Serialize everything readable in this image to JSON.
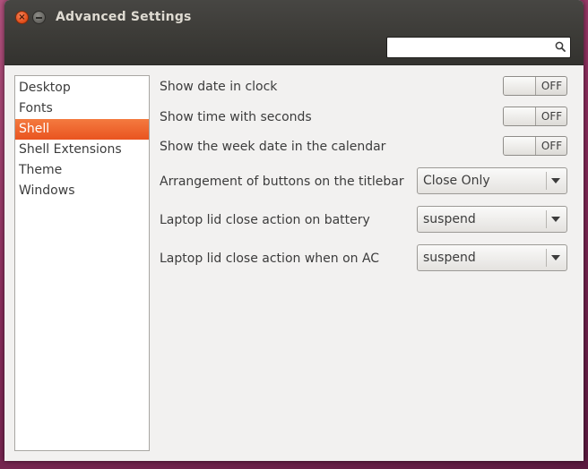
{
  "window": {
    "title": "Advanced Settings"
  },
  "search": {
    "value": "",
    "placeholder": ""
  },
  "sidebar": {
    "items": [
      {
        "label": "Desktop",
        "selected": false
      },
      {
        "label": "Fonts",
        "selected": false
      },
      {
        "label": "Shell",
        "selected": true
      },
      {
        "label": "Shell Extensions",
        "selected": false
      },
      {
        "label": "Theme",
        "selected": false
      },
      {
        "label": "Windows",
        "selected": false
      }
    ]
  },
  "settings": {
    "date_in_clock": {
      "label": "Show date in clock",
      "state": "OFF"
    },
    "time_with_seconds": {
      "label": "Show time with seconds",
      "state": "OFF"
    },
    "week_date": {
      "label": "Show the week date in the calendar",
      "state": "OFF"
    },
    "titlebar_buttons": {
      "label": "Arrangement of buttons on the titlebar",
      "value": "Close Only"
    },
    "lid_battery": {
      "label": "Laptop lid close action on battery",
      "value": "suspend"
    },
    "lid_ac": {
      "label": "Laptop lid close action when on AC",
      "value": "suspend"
    }
  },
  "colors": {
    "accent": "#e95420",
    "titlebar": "#3c3b37",
    "background": "#f2f1f0"
  },
  "icons": {
    "close": "close-icon",
    "minimize": "minimize-icon",
    "search": "search-icon",
    "dropdown": "chevron-down-icon"
  }
}
